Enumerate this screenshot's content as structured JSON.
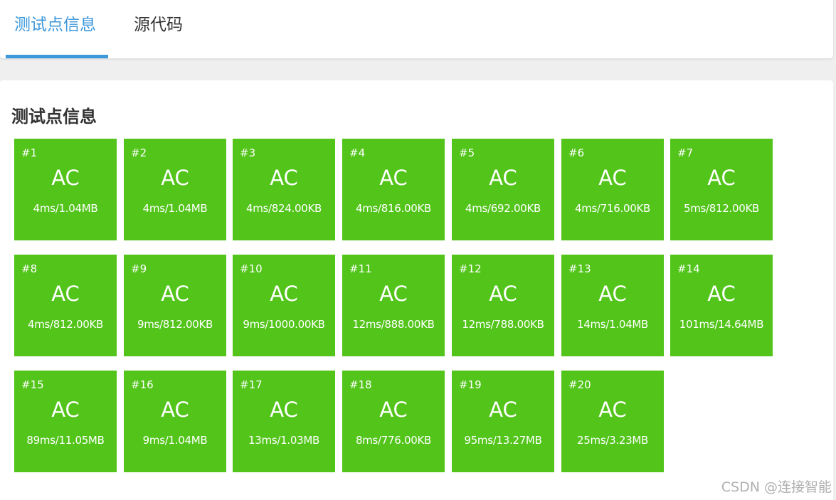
{
  "tabs": [
    {
      "label": "测试点信息",
      "active": true
    },
    {
      "label": "源代码",
      "active": false
    }
  ],
  "section_title": "测试点信息",
  "accent_color": "#3d98db",
  "ac_color": "#52c41a",
  "testcases": [
    {
      "id": "#1",
      "status": "AC",
      "metrics": "4ms/1.04MB"
    },
    {
      "id": "#2",
      "status": "AC",
      "metrics": "4ms/1.04MB"
    },
    {
      "id": "#3",
      "status": "AC",
      "metrics": "4ms/824.00KB"
    },
    {
      "id": "#4",
      "status": "AC",
      "metrics": "4ms/816.00KB"
    },
    {
      "id": "#5",
      "status": "AC",
      "metrics": "4ms/692.00KB"
    },
    {
      "id": "#6",
      "status": "AC",
      "metrics": "4ms/716.00KB"
    },
    {
      "id": "#7",
      "status": "AC",
      "metrics": "5ms/812.00KB"
    },
    {
      "id": "#8",
      "status": "AC",
      "metrics": "4ms/812.00KB"
    },
    {
      "id": "#9",
      "status": "AC",
      "metrics": "9ms/812.00KB"
    },
    {
      "id": "#10",
      "status": "AC",
      "metrics": "9ms/1000.00KB"
    },
    {
      "id": "#11",
      "status": "AC",
      "metrics": "12ms/888.00KB"
    },
    {
      "id": "#12",
      "status": "AC",
      "metrics": "12ms/788.00KB"
    },
    {
      "id": "#13",
      "status": "AC",
      "metrics": "14ms/1.04MB"
    },
    {
      "id": "#14",
      "status": "AC",
      "metrics": "101ms/14.64MB"
    },
    {
      "id": "#15",
      "status": "AC",
      "metrics": "89ms/11.05MB"
    },
    {
      "id": "#16",
      "status": "AC",
      "metrics": "9ms/1.04MB"
    },
    {
      "id": "#17",
      "status": "AC",
      "metrics": "13ms/1.03MB"
    },
    {
      "id": "#18",
      "status": "AC",
      "metrics": "8ms/776.00KB"
    },
    {
      "id": "#19",
      "status": "AC",
      "metrics": "95ms/13.27MB"
    },
    {
      "id": "#20",
      "status": "AC",
      "metrics": "25ms/3.23MB"
    }
  ],
  "watermark": "CSDN @连接智能"
}
